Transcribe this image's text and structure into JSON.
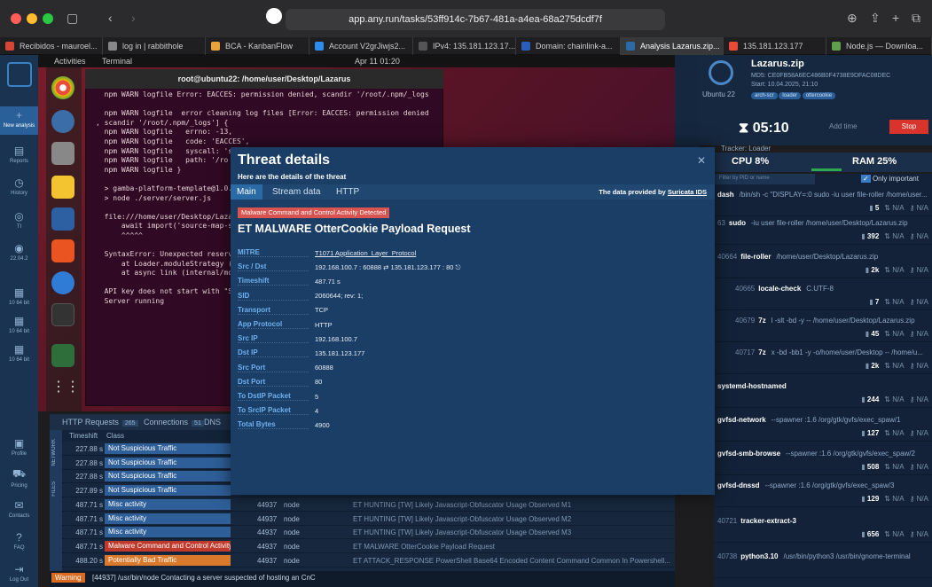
{
  "browser": {
    "url": "app.any.run/tasks/53ff914c-7b67-481a-a4ea-68a275dcdf7f",
    "tabs": [
      {
        "label": "Recibidos - mauroel...",
        "color": "#d44638"
      },
      {
        "label": "log in | rabbithole",
        "color": "#888888"
      },
      {
        "label": "BCA - KanbanFlow",
        "color": "#e8a33d"
      },
      {
        "label": "Account V2grJiwjs2...",
        "color": "#2d8cf0"
      },
      {
        "label": "IPv4: 135.181.123.17...",
        "color": "#555555"
      },
      {
        "label": "Domain: chainlink-a...",
        "color": "#2a5fb8"
      },
      {
        "label": "Analysis Lazarus.zip...",
        "color": "#2a6aa5"
      },
      {
        "label": "135.181.123.177",
        "color": "#e84a3a"
      },
      {
        "label": "Node.js — Downloa...",
        "color": "#5fa04e"
      }
    ]
  },
  "nav": [
    {
      "label": "New analysis",
      "icon": "plus-icon"
    },
    {
      "label": "Reports",
      "icon": "document-icon"
    },
    {
      "label": "History",
      "icon": "clock-icon"
    },
    {
      "label": "TI",
      "icon": "globe-icon"
    },
    {
      "label": "22.04.2",
      "icon": "ubuntu-icon"
    },
    {
      "label": "10 64 bit",
      "icon": "windows-icon"
    },
    {
      "label": "10 64 bit",
      "icon": "windows-icon"
    },
    {
      "label": "10 64 bit",
      "icon": "windows-icon"
    },
    {
      "label": "Profile",
      "icon": "profile-icon"
    },
    {
      "label": "Pricing",
      "icon": "cart-icon"
    },
    {
      "label": "Contacts",
      "icon": "mail-icon"
    },
    {
      "label": "FAQ",
      "icon": "help-icon"
    },
    {
      "label": "Log Out",
      "icon": "logout-icon"
    }
  ],
  "vm": {
    "activities": "Activities",
    "terminal_app": "Terminal",
    "clock": "Apr 11  01:20",
    "terminal_title": "root@ubuntu22: /home/user/Desktop/Lazarus",
    "terminal_lines": [
      "  npm WARN logfile Error: EACCES: permission denied, scandir '/root/.npm/_logs",
      "",
      "  npm WARN logfile  error cleaning log files [Error: EACCES: permission denied",
      ", scandir '/root/.npm/_logs'] {",
      "  npm WARN logfile   errno: -13,",
      "  npm WARN logfile   code: 'EACCES',",
      "  npm WARN logfile   syscall: 's",
      "  npm WARN logfile   path: '/ro",
      "  npm WARN logfile }",
      "",
      "  > gamba-platform-template@1.0.",
      "  > node ./server/server.js",
      "",
      "  file:///home/user/Desktop/Laza",
      "      await import('source-map-s",
      "      ^^^^^",
      "",
      "  SyntaxError: Unexpected reserv",
      "      at Loader.moduleStrategy (",
      "      at async link (internal/mo",
      "",
      "  API key does not start with \"S",
      "  Server running"
    ]
  },
  "info": {
    "filename": "Lazarus.zip",
    "md5": "MD5: CE0FB58A6EC486B0F4738E9DFAC08DEC",
    "start": "Start: 10.04.2025, 21:10",
    "tags": [
      "arch-scr",
      "loader",
      "ottercookie"
    ],
    "os": "Ubuntu 22",
    "timer": "05:10",
    "add_time": "Add time",
    "stop": "Stop",
    "tracker": "Tracker: Loader",
    "cpu": "CPU  8%",
    "ram": "RAM  25%",
    "filter_placeholder": "Filter by PID or name",
    "only_important": "Only important"
  },
  "processes": [
    {
      "pid": "",
      "name": "dash",
      "cmd": "/bin/sh -c \"DISPLAY=:0 sudo -iu user file-roller /home/user...",
      "files": "5",
      "net": "N/A",
      "reg": "N/A"
    },
    {
      "pid": "63",
      "name": "sudo",
      "cmd": "-iu user file-roller /home/user/Desktop/Lazarus.zip",
      "files": "392",
      "net": "N/A",
      "reg": "N/A"
    },
    {
      "pid": "40664",
      "name": "file-roller",
      "cmd": "/home/user/Desktop/Lazarus.zip",
      "files": "2k",
      "net": "N/A",
      "reg": "N/A"
    },
    {
      "pid": "40665",
      "name": "locale-check",
      "cmd": "C.UTF-8",
      "files": "7",
      "net": "N/A",
      "reg": "N/A"
    },
    {
      "pid": "40679",
      "name": "7z",
      "cmd": "l -slt -bd -y -- /home/user/Desktop/Lazarus.zip",
      "files": "45",
      "net": "N/A",
      "reg": "N/A"
    },
    {
      "pid": "40717",
      "name": "7z",
      "cmd": "x -bd -bb1 -y -o/home/user/Desktop -- /home/u...",
      "files": "2k",
      "net": "N/A",
      "reg": "N/A"
    },
    {
      "pid": "",
      "name": "systemd-hostnamed",
      "cmd": "",
      "files": "244",
      "net": "N/A",
      "reg": "N/A"
    },
    {
      "pid": "",
      "name": "gvfsd-network",
      "cmd": "--spawner :1.6 /org/gtk/gvfs/exec_spaw/1",
      "files": "127",
      "net": "N/A",
      "reg": "N/A"
    },
    {
      "pid": "",
      "name": "gvfsd-smb-browse",
      "cmd": "--spawner :1.6 /org/gtk/gvfs/exec_spaw/2",
      "files": "508",
      "net": "N/A",
      "reg": "N/A"
    },
    {
      "pid": "",
      "name": "gvfsd-dnssd",
      "cmd": "--spawner :1.6 /org/gtk/gvfs/exec_spaw/3",
      "files": "129",
      "net": "N/A",
      "reg": "N/A"
    },
    {
      "pid": "40721",
      "name": "tracker-extract-3",
      "cmd": "",
      "files": "656",
      "net": "N/A",
      "reg": "N/A"
    },
    {
      "pid": "40738",
      "name": "python3.10",
      "cmd": "/usr/bin/python3 /usr/bin/gnome-terminal",
      "files": "",
      "net": "",
      "reg": ""
    }
  ],
  "network": {
    "tabs": [
      {
        "label": "HTTP Requests",
        "count": "265"
      },
      {
        "label": "Connections",
        "count": "51"
      },
      {
        "label": "DNS",
        "count": ""
      }
    ],
    "col_timeshift": "Timeshift",
    "col_class": "Class",
    "side_labels": [
      "NETWORK",
      "FILES"
    ],
    "rows": [
      {
        "t": "227.88 s",
        "cls": "Not Suspicious Traffic",
        "color": "#2e5f98",
        "pid": "",
        "pn": "",
        "msg": ""
      },
      {
        "t": "227.88 s",
        "cls": "Not Suspicious Traffic",
        "color": "#2e5f98",
        "pid": "",
        "pn": "",
        "msg": ""
      },
      {
        "t": "227.88 s",
        "cls": "Not Suspicious Traffic",
        "color": "#2e5f98",
        "pid": "",
        "pn": "",
        "msg": ""
      },
      {
        "t": "227.89 s",
        "cls": "Not Suspicious Traffic",
        "color": "#2e5f98",
        "pid": "",
        "pn": "",
        "msg": ""
      },
      {
        "t": "487.71 s",
        "cls": "Misc activity",
        "color": "#2e5f98",
        "pid": "44937",
        "pn": "node",
        "msg": "ET HUNTING [TW] Likely Javascript-Obfuscator Usage Observed M1"
      },
      {
        "t": "487.71 s",
        "cls": "Misc activity",
        "color": "#2e5f98",
        "pid": "44937",
        "pn": "node",
        "msg": "ET HUNTING [TW] Likely Javascript-Obfuscator Usage Observed M2"
      },
      {
        "t": "487.71 s",
        "cls": "Misc activity",
        "color": "#2e5f98",
        "pid": "44937",
        "pn": "node",
        "msg": "ET HUNTING [TW] Likely Javascript-Obfuscator Usage Observed M3"
      },
      {
        "t": "487.71 s",
        "cls": "Malware Command and Control Activity ...",
        "color": "#c0392b",
        "pid": "44937",
        "pn": "node",
        "msg": "ET MALWARE OtterCookie Payload Request"
      },
      {
        "t": "488.20 s",
        "cls": "Potentially Bad Traffic",
        "color": "#d9792b",
        "pid": "44937",
        "pn": "node",
        "msg": "ET ATTACK_RESPONSE PowerShell Base64 Encoded Content Command Common In Powershell..."
      }
    ],
    "warning_label": "Warning",
    "warning_text": "[44937] /usr/bin/node  Contacting a server suspected of hosting an CnC"
  },
  "modal": {
    "title": "Threat details",
    "subtitle": "Here are the details of the threat",
    "tabs": [
      "Main",
      "Stream data",
      "HTTP"
    ],
    "provided_prefix": "The data provided by ",
    "provided_link": "Suricata IDS",
    "tag": "Malware Command and Control Activity Detected",
    "signature": "ET MALWARE OtterCookie Payload Request",
    "details": [
      {
        "label": "MITRE",
        "value": "T1071 Application_Layer_Protocol",
        "link": true
      },
      {
        "label": "Src / Dst",
        "value": "192.168.100.7 : 60888  ⇄  135.181.123.177 : 80  ⎋",
        "link": false
      },
      {
        "label": "Timeshift",
        "value": "487.71 s",
        "link": false
      },
      {
        "label": "SID",
        "value": "2060644; rev: 1;",
        "link": false
      },
      {
        "label": "Transport",
        "value": "TCP",
        "link": false
      },
      {
        "label": "App Protocol",
        "value": "HTTP",
        "link": false
      },
      {
        "label": "Src IP",
        "value": "192.168.100.7",
        "link": false
      },
      {
        "label": "Dst IP",
        "value": "135.181.123.177",
        "link": false
      },
      {
        "label": "Src Port",
        "value": "60888",
        "link": false
      },
      {
        "label": "Dst Port",
        "value": "80",
        "link": false
      },
      {
        "label": "To DstIP Packet",
        "value": "5",
        "link": false
      },
      {
        "label": "To SrcIP Packet",
        "value": "4",
        "link": false
      },
      {
        "label": "Total Bytes",
        "value": "4900",
        "link": false
      }
    ]
  }
}
